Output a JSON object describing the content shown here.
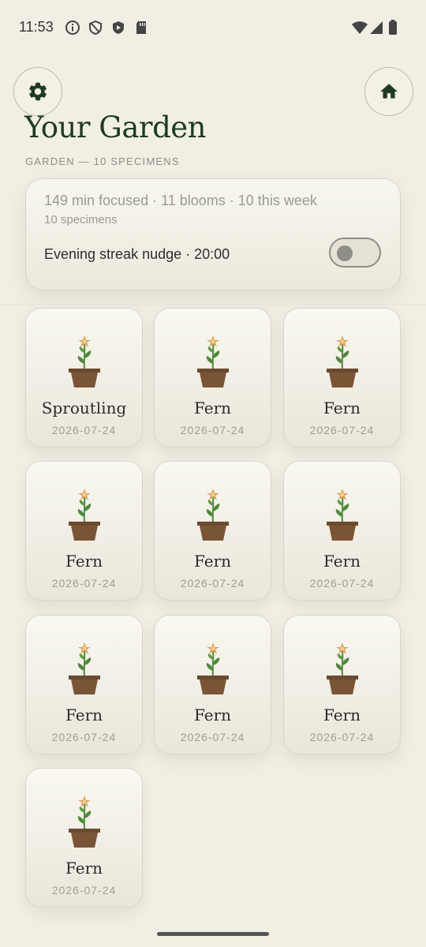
{
  "status_bar": {
    "time": "11:53",
    "left_icons": [
      "info-icon",
      "shield-icon",
      "play-shield-icon",
      "sd-card-icon"
    ],
    "right_icons": [
      "wifi-icon",
      "signal-icon",
      "battery-icon"
    ]
  },
  "header": {
    "settings_icon": "gear-icon",
    "home_icon": "home-icon",
    "title": "Your Garden",
    "subtitle": "GARDEN — 10 SPECIMENS"
  },
  "stats": {
    "summary": "149 min focused · 11 blooms · 10 this week",
    "count": "10 specimens",
    "nudge_label": "Evening streak nudge · 20:00",
    "nudge_enabled": false
  },
  "specimens": [
    {
      "name": "Sproutling",
      "date": "2026-07-24"
    },
    {
      "name": "Fern",
      "date": "2026-07-24"
    },
    {
      "name": "Fern",
      "date": "2026-07-24"
    },
    {
      "name": "Fern",
      "date": "2026-07-24"
    },
    {
      "name": "Fern",
      "date": "2026-07-24"
    },
    {
      "name": "Fern",
      "date": "2026-07-24"
    },
    {
      "name": "Fern",
      "date": "2026-07-24"
    },
    {
      "name": "Fern",
      "date": "2026-07-24"
    },
    {
      "name": "Fern",
      "date": "2026-07-24"
    },
    {
      "name": "Fern",
      "date": "2026-07-24"
    }
  ],
  "colors": {
    "background": "#f1efe4",
    "title": "#1e3a24",
    "pot": "#7a5535",
    "stem": "#4f8a3c",
    "petal": "#e4a05a"
  }
}
